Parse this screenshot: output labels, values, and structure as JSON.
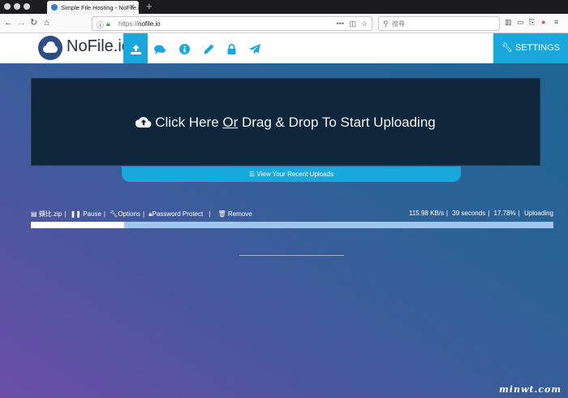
{
  "browser": {
    "tab_title": "Simple File Hosting - NoFile.io",
    "tab_close": "✕",
    "new_tab": "+",
    "url_scheme": "https://",
    "url_host": "nofile.io",
    "search_placeholder": "搜尋",
    "back_icon": "arrow-left-icon",
    "forward_icon": "arrow-right-icon",
    "reload_icon": "reload-icon",
    "home_icon": "home-icon"
  },
  "site": {
    "logo": "NoFile.io",
    "settings_label": "SETTINGS",
    "nav_icons": [
      "upload-icon",
      "chat-icon",
      "info-icon",
      "pencil-icon",
      "lock-icon",
      "paper-plane-icon"
    ]
  },
  "upload": {
    "prefix": "Click Here ",
    "or": "Or",
    "suffix": " Drag & Drop To Start Uploading",
    "recent_label": "View Your Recent Uploads"
  },
  "file": {
    "name": "擷比.zip",
    "pause": "Pause",
    "options": "Options",
    "password": "Password Protect",
    "remove": "Remove",
    "speed": "115.98 KB/s",
    "time": "39 seconds",
    "percent": "17.78%",
    "status": "Uploading",
    "progress": 0.1778
  },
  "colors": {
    "accent": "#19a8dc",
    "dropzone": "#10263a",
    "progress_track": "#9ec6ef"
  },
  "watermark": "minwt.com"
}
